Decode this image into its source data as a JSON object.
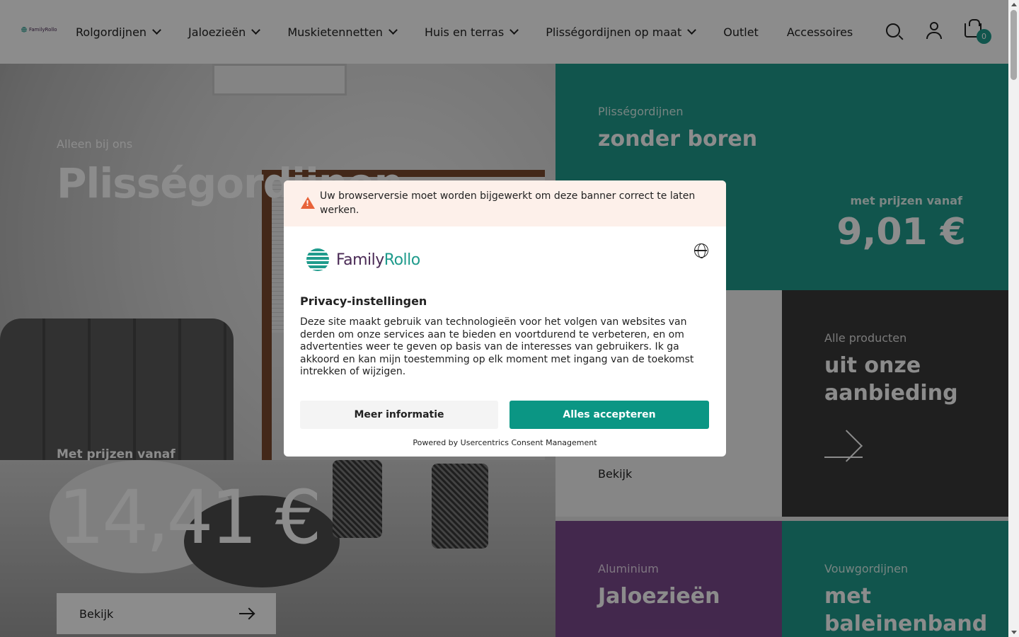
{
  "header": {
    "logo_text": "FamilyRollo",
    "nav": [
      {
        "label": "Rolgordijnen",
        "has_dropdown": true
      },
      {
        "label": "Jaloezieën",
        "has_dropdown": true
      },
      {
        "label": "Muskietennetten",
        "has_dropdown": true
      },
      {
        "label": "Huis en terras",
        "has_dropdown": true
      },
      {
        "label": "Plisségordijnen op maat",
        "has_dropdown": true
      },
      {
        "label": "Outlet",
        "has_dropdown": false
      },
      {
        "label": "Accessoires",
        "has_dropdown": false
      }
    ],
    "icons": [
      "search-icon",
      "user-icon",
      "cart-icon"
    ],
    "cart_count": "0"
  },
  "hero": {
    "eyebrow": "Alleen bij ons",
    "title": "Plisségordijnen",
    "price_label": "Met prijzen vanaf",
    "price": "14,41 €",
    "button_label": "Bekijk"
  },
  "tiles": {
    "t1": {
      "eyebrow": "Plisségordijnen",
      "title": "zonder boren",
      "price_label": "met prijzen vanaf",
      "price": "9,01 €"
    },
    "t2": {
      "link_label": "Bekijk"
    },
    "t3": {
      "eyebrow": "Alle producten",
      "title_line1": "uit onze",
      "title_line2": "aanbieding"
    },
    "t4": {
      "eyebrow": "Aluminium",
      "title": "Jaloezieën"
    },
    "t5": {
      "eyebrow": "Vouwgordijnen",
      "title_line1": "met",
      "title_line2": "baleinenband"
    }
  },
  "consent": {
    "warning": "Uw browserversie moet worden bijgewerkt om deze banner correct te laten werken.",
    "logo_text_a": "Family",
    "logo_text_b": "Rollo",
    "title": "Privacy-instellingen",
    "body": "Deze site maakt gebruik van technologieën voor het volgen van websites van derden om onze services aan te bieden en voortdurend te verbeteren, en om advertenties weer te geven op basis van de interesses van gebruikers. Ik ga akkoord en kan mijn toestemming op elk moment met ingang van de toekomst intrekken of wijzigen.",
    "btn_more": "Meer informatie",
    "btn_accept": "Alles accepteren",
    "powered_by": "Powered by Usercentrics Consent Management"
  },
  "colors": {
    "teal": "#1f9b8c",
    "accept_button": "#0b9684",
    "purple": "#7b4a8c",
    "dark_tile": "#3a3a3a",
    "warning_bg": "#fdf0ea",
    "warning_icon": "#e8633a"
  }
}
